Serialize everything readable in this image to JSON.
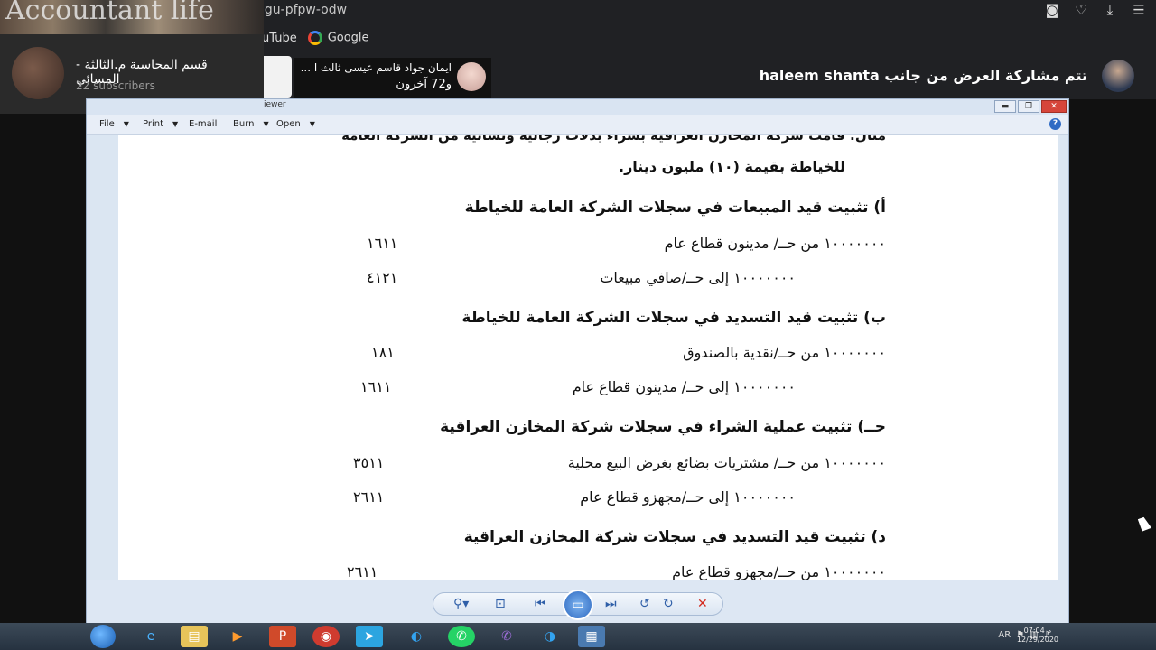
{
  "browser": {
    "url": "ggu-pfpw-odw",
    "bookmarks": [
      "uTube",
      "Google"
    ],
    "icons": [
      "camera-icon",
      "heart-icon",
      "download-icon",
      "menu-icon"
    ]
  },
  "channel": {
    "banner_text": "Accountant life",
    "name": "قسم المحاسبة م.الثالثة - المسائي",
    "subscribers": "22 subscribers"
  },
  "meet": {
    "user_name": "ايمان جواد قاسم عيسى ثالث ا ...",
    "user_others": "و72 آخرون",
    "presenter_text": "تتم مشاركة العرض من جانب haleem shanta"
  },
  "viewer": {
    "title": "iewer",
    "menus": [
      "File",
      "Print",
      "E-mail",
      "Burn",
      "Open"
    ],
    "help": "?"
  },
  "document": {
    "intro_partial": "مثال: قامت شركة المخازن العراقية بشراء بدلات رجالية ونسائية من الشركة العامة",
    "intro_line2": "للخياطة بقيمة (١٠) مليون دينار.",
    "sections": [
      {
        "heading": "أ) تثبيت قيد المبيعات في سجلات الشركة العامة للخياطة",
        "entries": [
          {
            "text": "١٠٠٠٠٠٠٠ من حــ/ مدينون قطاع عام",
            "code": "١٦١١"
          },
          {
            "text": "١٠٠٠٠٠٠٠ إلى حــ/صافي مبيعات",
            "code": "٤١٢١"
          }
        ]
      },
      {
        "heading": "ب) تثبيت قيد التسديد في سجلات الشركة العامة للخياطة",
        "entries": [
          {
            "text": "١٠٠٠٠٠٠٠ من حــ/نقدية بالصندوق",
            "code": "١٨١"
          },
          {
            "text": "١٠٠٠٠٠٠٠ إلى حــ/ مدينون قطاع عام",
            "code": "١٦١١"
          }
        ]
      },
      {
        "heading": "حــ) تثبيت عملية الشراء في سجلات شركة المخازن العراقية",
        "entries": [
          {
            "text": "١٠٠٠٠٠٠٠ من حــ/ مشتريات بضائع بغرض البيع محلية",
            "code": "٣٥١١"
          },
          {
            "text": "١٠٠٠٠٠٠٠ إلى حــ/مجهزو قطاع عام",
            "code": "٢٦١١"
          }
        ]
      },
      {
        "heading": "د) تثبيت قيد التسديد في سجلات شركة المخازن العراقية",
        "entries": [
          {
            "text": "١٠٠٠٠٠٠٠ من حــ/مجهزو قطاع عام",
            "code": "٢٦١١"
          }
        ]
      }
    ]
  },
  "toolbar": {
    "buttons": [
      "zoom-icon",
      "fit-icon",
      "first-page-icon",
      "slideshow-icon",
      "last-page-icon",
      "rotate-left-icon",
      "rotate-right-icon",
      "delete-icon"
    ]
  },
  "taskbar": {
    "language": "AR",
    "time": "07:04 م",
    "date": "12/29/2020",
    "apps": [
      "ie-icon",
      "explorer-icon",
      "media-icon",
      "powerpoint-icon",
      "chrome-icon",
      "telegram-icon",
      "edge-icon",
      "whatsapp-icon",
      "viber-icon",
      "edge-icon",
      "photo-viewer-icon"
    ]
  }
}
